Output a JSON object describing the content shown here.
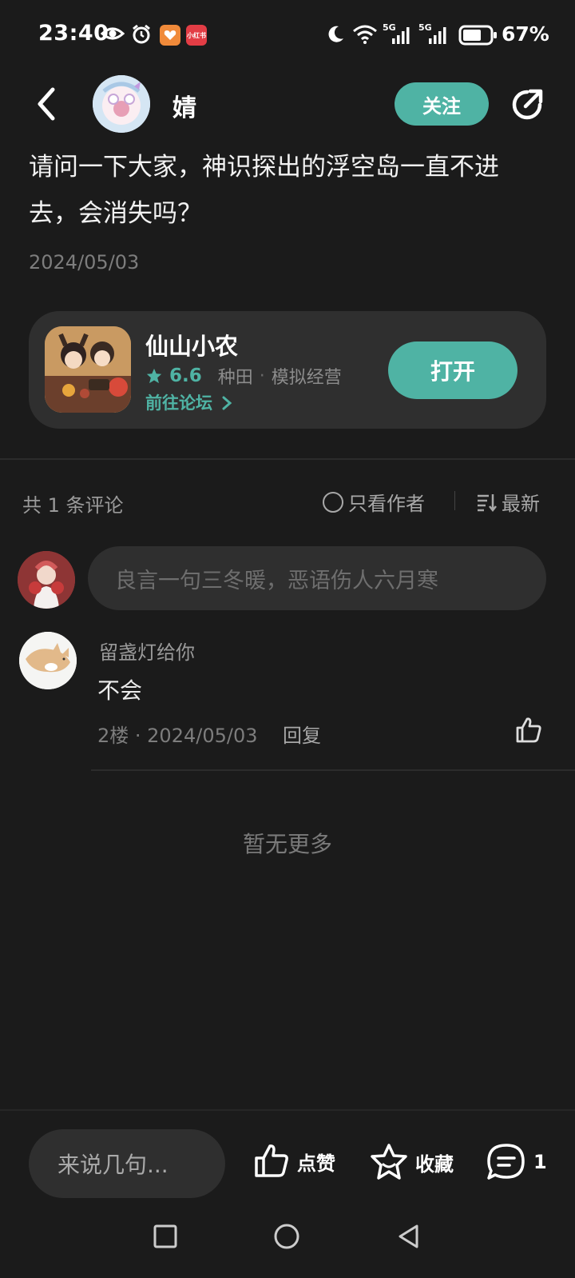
{
  "status_bar": {
    "time": "23:40",
    "mini_app_label": "小红书",
    "network_1": "5G",
    "network_2": "5G",
    "battery": "67%",
    "icons": [
      "eye-icon",
      "alarm-icon",
      "app-icon-orange",
      "app-icon-red",
      "moon-icon",
      "wifi-icon",
      "signal-icon",
      "signal-icon",
      "battery-icon"
    ]
  },
  "header": {
    "username": "婧",
    "follow_label": "关注",
    "icons": [
      "back-arrow-icon",
      "avatar",
      "share-icon"
    ]
  },
  "post": {
    "text": "请问一下大家，神识探出的浮空岛一直不进去，会消失吗？",
    "date": "2024/05/03"
  },
  "app_card": {
    "name": "仙山小农",
    "rating": "6.6",
    "tag1": "种田",
    "separator": "·",
    "tag2": "模拟经营",
    "forum_link": "前往论坛",
    "open_label": "打开"
  },
  "comments_header": {
    "count_label": "共 1 条评论",
    "author_only_label": "只看作者",
    "sort_label": "最新"
  },
  "comment_input": {
    "placeholder": "良言一句三冬暖，恶语伤人六月寒"
  },
  "comments": [
    {
      "user": "留盏灯给你",
      "text": "不会",
      "meta": "2楼 · 2024/05/03",
      "reply_label": "回复"
    }
  ],
  "no_more": "暂无更多",
  "bottom_bar": {
    "input_placeholder": "来说几句...",
    "like_label": "点赞",
    "fav_label": "收藏",
    "comment_count": "1"
  },
  "colors": {
    "accent": "#4fb3a4",
    "background": "#1b1b1b",
    "card": "#2f2f2f"
  }
}
